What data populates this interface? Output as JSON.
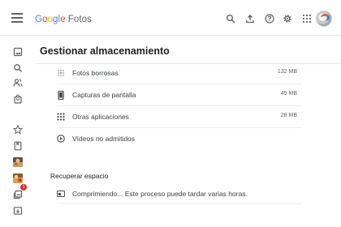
{
  "app": {
    "logo_letters": [
      "G",
      "o",
      "o",
      "g",
      "l",
      "e"
    ],
    "product": "Fotos"
  },
  "header_icons": [
    "search-icon",
    "upload-icon",
    "help-icon",
    "settings-icon",
    "apps-icon",
    "avatar"
  ],
  "sidebar_icons": [
    "photos-icon",
    "search-icon",
    "people-icon",
    "shopping-bag-icon",
    "star-icon",
    "bookmark-icon",
    "album-thumb-1",
    "album-thumb-2",
    "utilities-icon",
    "archive-icon"
  ],
  "sidebar_badge": "1",
  "page": {
    "title": "Gestionar almacenamiento"
  },
  "categories": [
    {
      "icon": "blurry-photos-icon",
      "label": "Fotos borrosas",
      "size": "132 MB"
    },
    {
      "icon": "screenshot-icon",
      "label": "Capturas de pantalla",
      "size": "45 MB"
    },
    {
      "icon": "other-apps-icon",
      "label": "Otras aplicaciones",
      "size": "28 MB"
    },
    {
      "icon": "unsupported-video-icon",
      "label": "Vídeos no admitidos",
      "size": ""
    }
  ],
  "recover": {
    "title": "Recuperar espacio",
    "status": "Comprimiendo... Este proceso puede tardar varias horas."
  },
  "colors": {
    "g_blue": "#4285f4",
    "g_red": "#ea4335",
    "g_yellow": "#fbbc05",
    "g_green": "#34a853",
    "badge_red": "#d93025"
  }
}
